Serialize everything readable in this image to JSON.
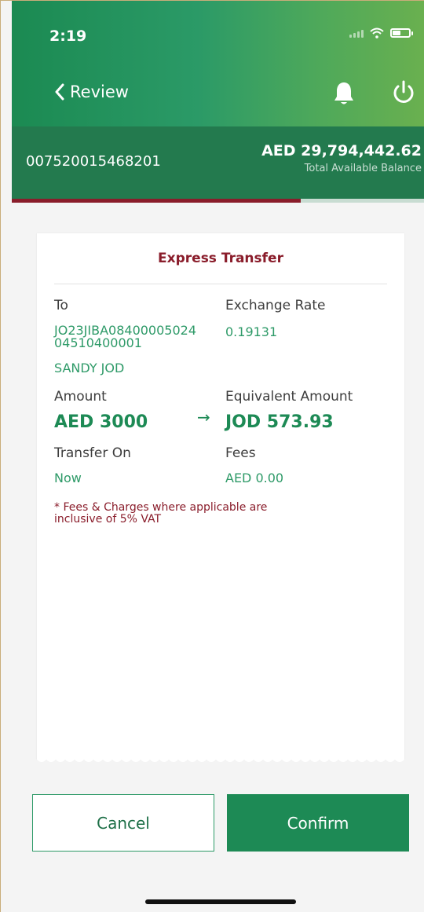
{
  "status_bar": {
    "time": "2:19"
  },
  "nav": {
    "back_label": "Review"
  },
  "account": {
    "number": "007520015468201",
    "balance": "AED 29,794,442.62",
    "balance_caption": "Total Available Balance",
    "balance_bar_fill_percent": 70
  },
  "transfer": {
    "title": "Express Transfer",
    "to_label": "To",
    "iban_line1": "JO23JIBA08400005024",
    "iban_line2": "04510400001",
    "beneficiary": "SANDY JOD",
    "exchange_rate_label": "Exchange Rate",
    "exchange_rate": "0.19131",
    "amount_label": "Amount",
    "amount": "AED 3000",
    "equivalent_label": "Equivalent Amount",
    "equivalent": "JOD 573.93",
    "transfer_on_label": "Transfer On",
    "transfer_on": "Now",
    "fees_label": "Fees",
    "fees": "AED 0.00",
    "note_line1": "* Fees & Charges where applicable are",
    "note_line2": "inclusive of 5% VAT"
  },
  "actions": {
    "cancel": "Cancel",
    "confirm": "Confirm"
  },
  "colors": {
    "primary_green": "#1d8a55",
    "accent_maroon": "#8a1d2b"
  },
  "icons": [
    "chevron-left-icon",
    "bell-icon",
    "power-icon",
    "arrow-right-icon"
  ]
}
